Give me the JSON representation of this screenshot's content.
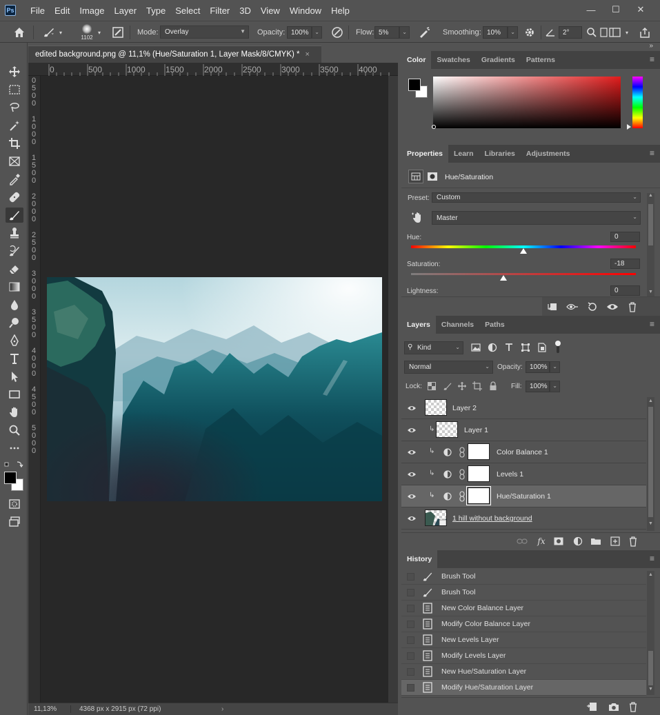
{
  "menubar": {
    "logo": "Ps",
    "items": [
      "File",
      "Edit",
      "Image",
      "Layer",
      "Type",
      "Select",
      "Filter",
      "3D",
      "View",
      "Window",
      "Help"
    ],
    "window_controls": [
      "—",
      "☐",
      "✕"
    ]
  },
  "options_bar": {
    "brush_size": "1102",
    "mode_label": "Mode:",
    "mode_value": "Overlay",
    "opacity_label": "Opacity:",
    "opacity_value": "100%",
    "flow_label": "Flow:",
    "flow_value": "5%",
    "smoothing_label": "Smoothing:",
    "smoothing_value": "10%",
    "angle_value": "2°"
  },
  "document": {
    "tab_title": "edited background.png @ 11,1% (Hue/Saturation 1, Layer Mask/8/CMYK) *",
    "close": "×",
    "ruler_top": [
      "0",
      "500",
      "1000",
      "1500",
      "2000",
      "2500",
      "3000",
      "3500",
      "4000"
    ],
    "ruler_left": [
      "0",
      "5",
      "0",
      "0",
      "1",
      "0",
      "0",
      "0",
      "1",
      "5",
      "0",
      "0",
      "2",
      "0",
      "0",
      "0",
      "2",
      "5",
      "0",
      "0",
      "3",
      "0",
      "0",
      "0",
      "3",
      "5",
      "0",
      "0",
      "4",
      "0",
      "0",
      "0",
      "4",
      "5",
      "0",
      "0",
      "5",
      "0",
      "0",
      "0"
    ],
    "zoom": "11,13%",
    "dimensions": "4368 px x 2915 px (72 ppi)",
    "status_arrow": "›"
  },
  "color_panel": {
    "tabs": [
      "Color",
      "Swatches",
      "Gradients",
      "Patterns"
    ],
    "active_tab": "Color",
    "hue_color": "#e11c1c"
  },
  "properties_panel": {
    "tabs": [
      "Properties",
      "Learn",
      "Libraries",
      "Adjustments"
    ],
    "active_tab": "Properties",
    "title": "Hue/Saturation",
    "preset_label": "Preset:",
    "preset_value": "Custom",
    "channel_value": "Master",
    "hue_label": "Hue:",
    "hue_value": "0",
    "saturation_label": "Saturation:",
    "saturation_value": "-18",
    "lightness_label": "Lightness:",
    "lightness_value": "0",
    "hue_slider_fraction": 0.5,
    "saturation_slider_fraction": 0.41
  },
  "layers_panel": {
    "tabs": [
      "Layers",
      "Channels",
      "Paths"
    ],
    "active_tab": "Layers",
    "filter_label": "Kind",
    "blend_mode": "Normal",
    "opacity_label": "Opacity:",
    "opacity_value": "100%",
    "lock_label": "Lock:",
    "fill_label": "Fill:",
    "fill_value": "100%",
    "layers": [
      {
        "name": "Layer 2",
        "type": "pixel",
        "clipped": false,
        "selected": false
      },
      {
        "name": "Layer 1",
        "type": "pixel",
        "clipped": true,
        "selected": false
      },
      {
        "name": "Color Balance 1",
        "type": "adjustment",
        "clipped": true,
        "selected": false
      },
      {
        "name": "Levels 1",
        "type": "adjustment",
        "clipped": true,
        "selected": false
      },
      {
        "name": "Hue/Saturation 1",
        "type": "adjustment",
        "clipped": true,
        "selected": true
      },
      {
        "name": "1 hill without background ",
        "type": "smart",
        "clipped": false,
        "selected": false
      }
    ]
  },
  "history_panel": {
    "tabs": [
      "History"
    ],
    "items": [
      {
        "label": "Brush Tool",
        "icon": "brush-icon"
      },
      {
        "label": "Brush Tool",
        "icon": "brush-icon"
      },
      {
        "label": "New Color Balance Layer",
        "icon": "document-icon"
      },
      {
        "label": "Modify Color Balance Layer",
        "icon": "document-icon"
      },
      {
        "label": "New Levels Layer",
        "icon": "document-icon"
      },
      {
        "label": "Modify Levels Layer",
        "icon": "document-icon"
      },
      {
        "label": "New Hue/Saturation Layer",
        "icon": "document-icon"
      },
      {
        "label": "Modify Hue/Saturation Layer",
        "icon": "document-icon"
      }
    ],
    "selected_index": 7
  }
}
